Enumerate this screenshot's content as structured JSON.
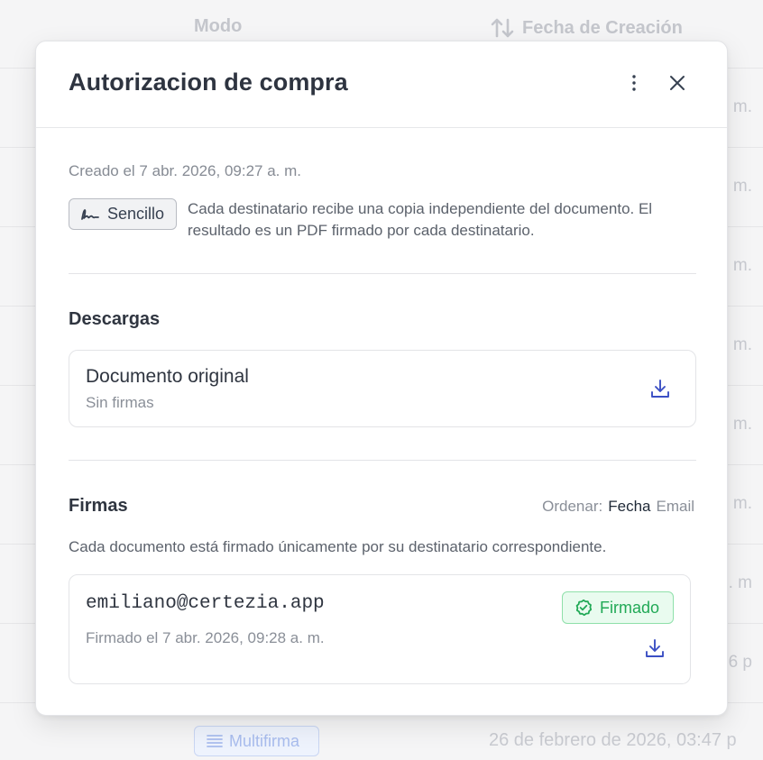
{
  "background": {
    "columns": {
      "modo": "Modo",
      "fecha": "Fecha de Creación"
    },
    "row_time_fragments": [
      "m.",
      "m.",
      "m.",
      "m.",
      "m.",
      ". m.",
      "p. m",
      "06 p"
    ],
    "last_row": {
      "mode": "Multifirma",
      "date": "26 de febrero de 2026, 03:47 p"
    }
  },
  "modal": {
    "title": "Autorizacion de compra",
    "created": "Creado el 7 abr. 2026, 09:27 a. m.",
    "mode_badge": "Sencillo",
    "mode_description": "Cada destinatario recibe una copia independiente del documento. El resultado es un PDF firmado por cada destinatario.",
    "downloads": {
      "title": "Descargas",
      "document": {
        "name": "Documento original",
        "subtitle": "Sin firmas"
      }
    },
    "signatures": {
      "title": "Firmas",
      "sort_label": "Ordenar:",
      "sort_options": [
        "Fecha",
        "Email"
      ],
      "description": "Cada documento está firmado únicamente por su destinatario correspondiente.",
      "items": [
        {
          "email": "emiliano@certezia.app",
          "date": "Firmado el 7 abr. 2026, 09:28 a. m.",
          "status": "Firmado"
        }
      ]
    }
  },
  "colors": {
    "accent": "#3b4fc4",
    "success": "#21a956",
    "success_bg": "#e9fbef"
  },
  "icons": {
    "more": "more-vertical-icon",
    "close": "close-icon",
    "signature": "signature-icon",
    "download": "download-icon",
    "check": "check-circle-icon",
    "sort": "sort-arrows-icon",
    "list": "list-icon"
  }
}
